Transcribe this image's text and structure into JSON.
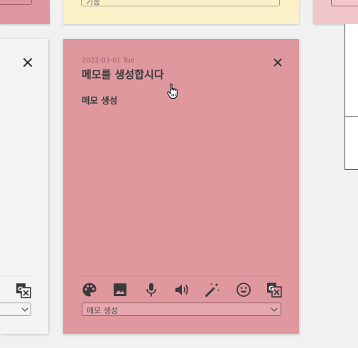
{
  "top_cards": {
    "middle_select_value": "기능"
  },
  "note": {
    "date": "2022-03-01 Tue",
    "title": "메모를 생성합시다",
    "body": "메모 생성",
    "footer_select_value": "메모 생성",
    "background_color": "#e0989f",
    "toolbar_icons": [
      "palette-icon",
      "image-icon",
      "microphone-icon",
      "speaker-icon",
      "magic-wand-icon",
      "emoji-icon",
      "translate-icon"
    ]
  }
}
